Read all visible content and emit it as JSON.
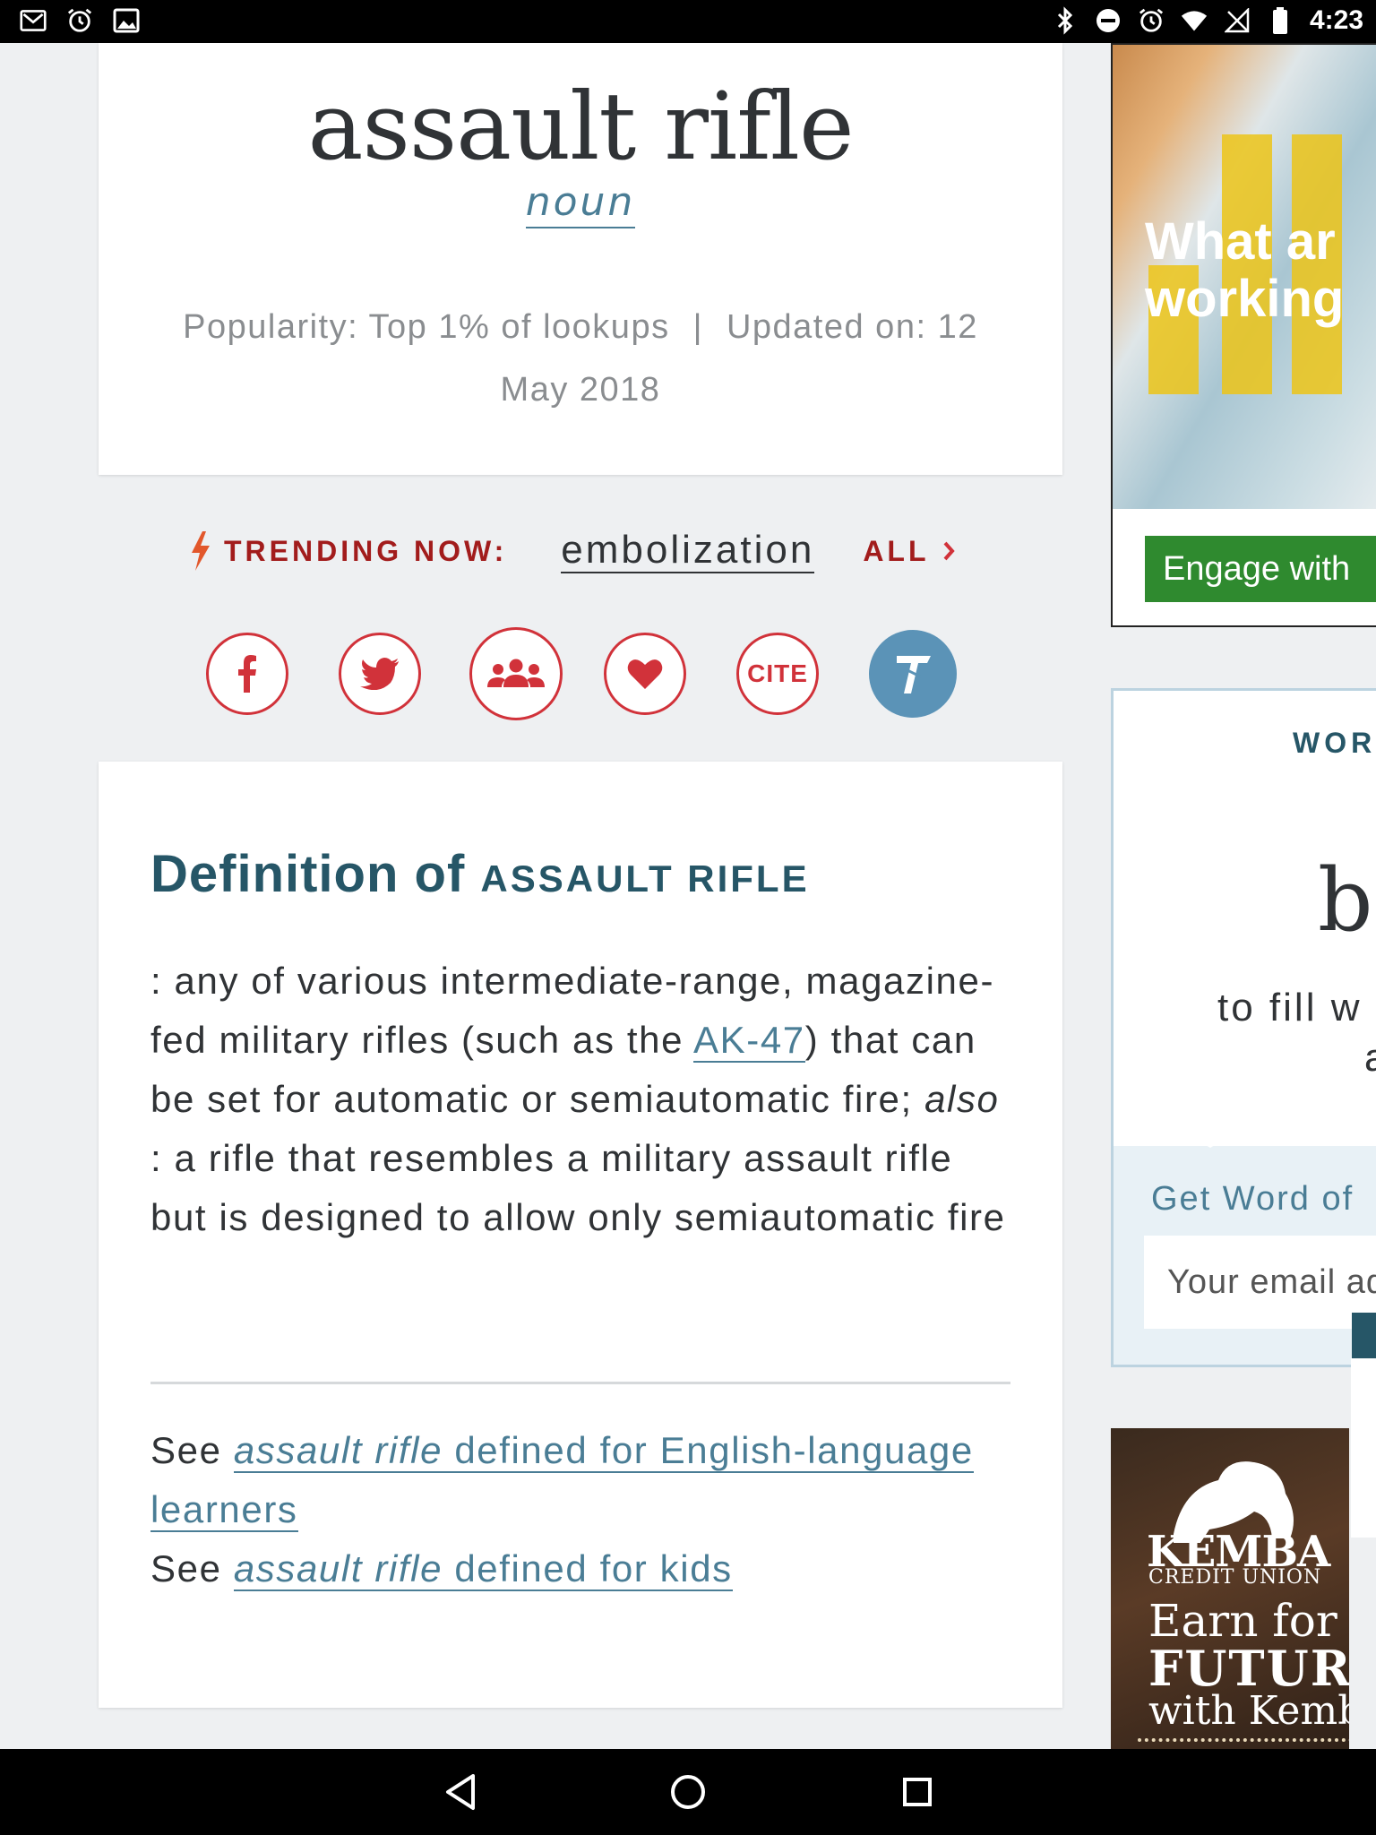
{
  "status_bar": {
    "time": "4:23",
    "left_icons": [
      "gmail-icon",
      "alarm-icon",
      "image-notification-icon"
    ],
    "right_icons": [
      "bluetooth-icon",
      "do-not-disturb-icon",
      "alarm-icon",
      "wifi-icon",
      "no-signal-icon",
      "battery-icon"
    ]
  },
  "entry": {
    "headword": "assault rifle",
    "part_of_speech": "noun",
    "popularity": "Popularity: Top 1% of lookups",
    "separator": "|",
    "updated_line1": "Updated on: 12",
    "updated_line2": "May 2018"
  },
  "trending": {
    "label": "TRENDING NOW:",
    "word": "embolization",
    "all_label": "ALL"
  },
  "share": {
    "items": [
      "facebook-icon",
      "twitter-icon",
      "people-icon",
      "heart-icon",
      "cite-button",
      "thesaurus-icon"
    ],
    "cite_label": "CITE"
  },
  "definition": {
    "title_prefix": "Definition of",
    "title_word": "ASSAULT RIFLE",
    "text_part1": ": any of various intermediate-range, magazine-fed military rifles (such as the ",
    "link_ak47": "AK-47",
    "text_part2": ") that can be set for automatic or semiautomatic fire; ",
    "also": "also",
    "text_part3": " : a rifle that resembles a military assault rifle but is designed to allow only semiautomatic fire",
    "see1_prefix": "See",
    "see1_word": "assault rifle",
    "see1_rest": " defined for English-language learners",
    "see2_prefix": "See",
    "see2_word": "assault rifle",
    "see2_rest": " defined for kids"
  },
  "ad_top": {
    "headline_line1": "What ar",
    "headline_line2": "working",
    "cta": "Engage with"
  },
  "word_of_day": {
    "label": "WOR",
    "word": "b",
    "desc_line1": "to fill w",
    "desc_line2": "a",
    "subscribe_label": "Get Word of",
    "email_placeholder": "Your email ad"
  },
  "ad_bottom": {
    "brand": "KEMBA",
    "brand_sub": "CREDIT UNION",
    "line1": "Earn for t",
    "line2": "FUTUR",
    "line3": "with Kemb"
  },
  "nav": {
    "buttons": [
      "back-button",
      "home-button",
      "recents-button"
    ]
  },
  "colors": {
    "accent_red": "#d1323a",
    "trending_red": "#a21c1c",
    "link_blue": "#4a7d95",
    "heading_teal": "#265667",
    "thesaurus_blue": "#5b93b7"
  }
}
